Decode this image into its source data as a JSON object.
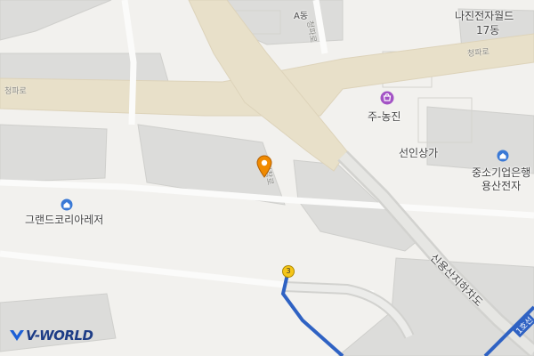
{
  "map": {
    "logo": {
      "text": "V-WORLD",
      "mark_color": "#1c5fd6",
      "text_color": "#1d3c86"
    },
    "labels": {
      "bldg_a": "A동",
      "road_cheongpa_top": "청파로",
      "road_cheongpa_left": "청파로",
      "road_cheongpa_right": "청파로",
      "najin_line1": "나진전자월드",
      "najin_line2": "17동",
      "junongjin": "주-농진",
      "seonin": "선인상가",
      "bank_line1": "중소기업은행",
      "bank_line2": "용산전자",
      "grand": "그랜드코리아레저",
      "road_center": "새창로",
      "road_underpass": "신용산지하차도",
      "line_label": "1호선"
    },
    "marker_number": "3",
    "colors": {
      "background": "#f2f1ee",
      "major_road": "#e8e0c9",
      "building": "#dcdcda",
      "subway_line": "#2f62c3",
      "pin": "#f08a00",
      "shopping_icon": "#a352c5",
      "bank_icon": "#3a79d6"
    }
  }
}
